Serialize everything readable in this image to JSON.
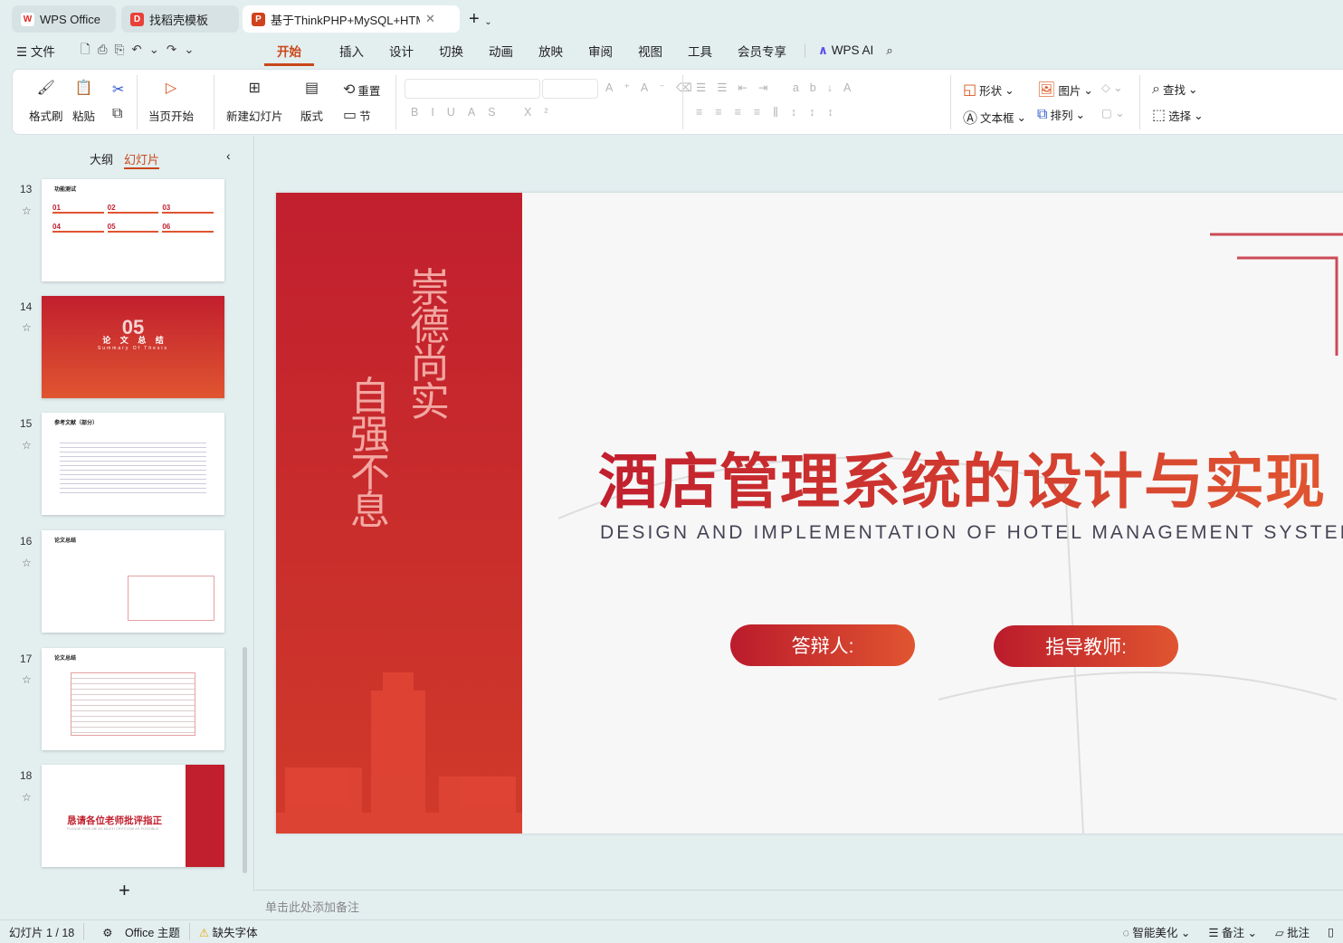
{
  "tabs": [
    {
      "label": "WPS Office",
      "icon": "wps-logo"
    },
    {
      "label": "找稻壳模板",
      "icon": "docer-logo"
    },
    {
      "label": "基于ThinkPHP+MySQL+HTM",
      "icon": "ppt-logo"
    }
  ],
  "menu": {
    "file": "文件",
    "items": [
      "开始",
      "插入",
      "设计",
      "切换",
      "动画",
      "放映",
      "审阅",
      "视图",
      "工具",
      "会员专享"
    ],
    "active": "开始",
    "ai": "WPS AI"
  },
  "ribbon": {
    "format_painter": "格式刷",
    "paste": "粘贴",
    "from_current": "当页开始",
    "new_slide": "新建幻灯片",
    "layout": "版式",
    "reset": "重置",
    "section": "节",
    "shape": "形状",
    "picture": "图片",
    "textbox": "文本框",
    "arrange": "排列",
    "find": "查找",
    "select": "选择"
  },
  "panel": {
    "outline_tab": "大纲",
    "slides_tab": "幻灯片",
    "active_tab": "幻灯片",
    "thumbs": [
      {
        "num": "13",
        "title": "功能测试",
        "items": [
          "01",
          "02",
          "03",
          "04",
          "05",
          "06"
        ]
      },
      {
        "num": "14",
        "big": "05",
        "title": "论 文 总 结",
        "subtitle": "Summary Of Thesis"
      },
      {
        "num": "15",
        "title": "参考文献（部分）"
      },
      {
        "num": "16",
        "title": "论文总结"
      },
      {
        "num": "17",
        "title": "论文总结"
      },
      {
        "num": "18",
        "title": "恳请各位老师批评指正",
        "subtitle": "PLEASE GIVE ME AS MUCH CRITICISM AS POSSIBLE"
      }
    ],
    "add_label": "+"
  },
  "slide": {
    "vertical1": "崇德尚实",
    "vertical2": "自强不息",
    "title": "酒店管理系统的设计与实现",
    "subtitle": "DESIGN AND IMPLEMENTATION OF HOTEL MANAGEMENT SYSTEM",
    "defender": "答辩人:",
    "advisor": "指导教师:",
    "colors": {
      "red": "#c11f2e",
      "orange": "#e05530"
    }
  },
  "notes": {
    "placeholder": "单击此处添加备注"
  },
  "status": {
    "slide_info": "幻灯片 1 / 18",
    "theme": "Office 主题",
    "missing_font": "缺失字体",
    "beautify": "智能美化",
    "notes": "备注",
    "comments": "批注"
  }
}
